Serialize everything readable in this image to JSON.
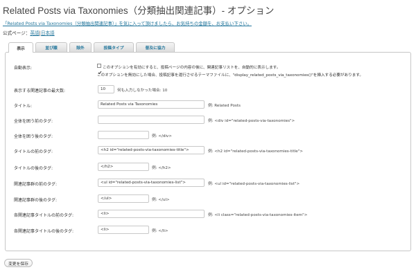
{
  "page": {
    "title": "Related Posts via Taxonomies（分類抽出関連記事）- オプション",
    "notice": "「Related Posts via Taxonomies（分類抽出関連記事）」を気に入って頂けましたら、お気持ちの金額を、お支払い下さい。",
    "official_label": "公式ページ：",
    "official_en": "英語",
    "official_sep": "|",
    "official_ja": "日本語"
  },
  "tabs": [
    {
      "label": "表示",
      "active": true
    },
    {
      "label": "並び順",
      "active": false
    },
    {
      "label": "除外",
      "active": false
    },
    {
      "label": "投稿タイプ",
      "active": false
    },
    {
      "label": "普及に協力",
      "active": false
    }
  ],
  "form": {
    "auto_display": {
      "label": "自動表示:",
      "checked": true,
      "text1": "このオプションを有効にすると、投稿ページの内容の後に、関連記事リストを、自動的に表示します。",
      "text2": "このオプションを無効にした場合、投稿記事を運行させるテーマファイルに、\"display_related_posts_via_taxonomies()\"を挿入する必要があります。"
    },
    "max_posts": {
      "label": "表示する関連記事の最大数:",
      "value": "10",
      "hint": "何も入力しなかった場合: 10"
    },
    "title": {
      "label": "タイトル:",
      "value": "Related Posts via Taxonomies",
      "hint": "例: Related Posts"
    },
    "before_all": {
      "label": "全体を囲う前のタグ:",
      "value": "",
      "hint": "例: <div id=\"related-posts-via-taxonomies\">"
    },
    "after_all": {
      "label": "全体を囲う後のタグ:",
      "value": "",
      "hint": "例: </div>"
    },
    "before_title": {
      "label": "タイトルの前のタグ:",
      "value": "<h2 id=\"related-posts-via-taxonomies-title\">",
      "hint": "例: <h2 id=\"related-posts-via-taxonomies-title\">"
    },
    "after_title": {
      "label": "タイトルの後のタグ:",
      "value": "</h2>",
      "hint": "例: </h2>"
    },
    "before_list": {
      "label": "関連記事群の前のタグ:",
      "value": "<ul id=\"related-posts-via-taxonomies-list\">",
      "hint": "例: <ul id=\"related-posts-via-taxonomies-list\">"
    },
    "after_list": {
      "label": "関連記事群の後のタグ:",
      "value": "</ul>",
      "hint": "例: </ul>"
    },
    "before_item": {
      "label": "各関連記事タイトルの前のタグ:",
      "value": "<li>",
      "hint": "例: <li class=\"related-posts-via-taxonomies-item\">"
    },
    "after_item": {
      "label": "各関連記事タイトルの後のタグ:",
      "value": "<li>",
      "hint": "例: </li>"
    }
  },
  "save_button": "変更を保存"
}
